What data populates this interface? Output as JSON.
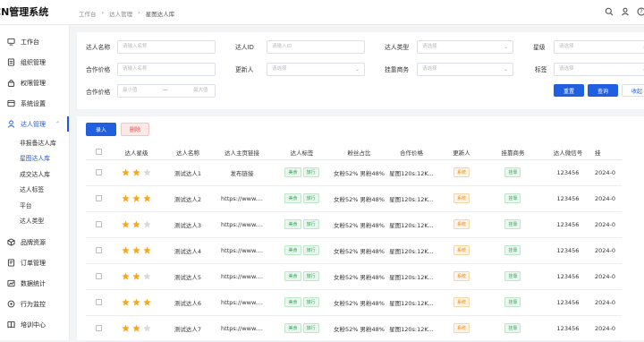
{
  "header": {
    "brand": "CN管理系统",
    "breadcrumb": [
      "工作台",
      "达人管理",
      "星图达人库"
    ]
  },
  "sidebar": {
    "items": [
      {
        "label": "工作台",
        "icon": "monitor-icon"
      },
      {
        "label": "组织管理",
        "icon": "org-icon"
      },
      {
        "label": "权限管理",
        "icon": "lock-icon"
      },
      {
        "label": "系统设置",
        "icon": "settings-icon"
      },
      {
        "label": "达人管理",
        "icon": "user-icon"
      }
    ],
    "sub_items": [
      "非报备达人库",
      "星图达人库",
      "成交达人库",
      "达人标签",
      "平台",
      "达人类型"
    ],
    "bottom_items": [
      {
        "label": "品牌资源",
        "icon": "cube-icon"
      },
      {
        "label": "订单管理",
        "icon": "order-icon"
      },
      {
        "label": "数据统计",
        "icon": "chart-icon"
      },
      {
        "label": "行为监控",
        "icon": "monitor-eye-icon"
      },
      {
        "label": "培训中心",
        "icon": "book-icon"
      }
    ]
  },
  "filters": {
    "name_label": "达人名称",
    "name_placeholder": "请输入名称",
    "id_label": "达人ID",
    "id_placeholder": "请输入ID",
    "type_label": "达人类型",
    "type_placeholder": "请选择",
    "level_label": "星级",
    "level_placeholder": "请选择",
    "price_label": "合作价格",
    "price_placeholder": "请输入名称",
    "updater_label": "更新人",
    "updater_placeholder": "请选择",
    "merchant_label": "挂靠商务",
    "merchant_placeholder": "请选择",
    "tag_label": "标签",
    "tag_placeholder": "请选择",
    "price_range_label": "合作价格",
    "min_placeholder": "最小值",
    "range_sep": "—",
    "max_placeholder": "最大值",
    "reset": "重置",
    "query": "查询",
    "collapse": "收起"
  },
  "actions": {
    "add": "录入",
    "delete": "删除"
  },
  "table": {
    "headers": [
      "达人星级",
      "达人名称",
      "达人主页链接",
      "达人标签",
      "粉丝占比",
      "合作价格",
      "更新人",
      "挂靠商务",
      "达人微信号",
      "挂"
    ],
    "rows": [
      {
        "stars": 2,
        "name": "测试达人1",
        "link": "发布链接",
        "tags": [
          "美食",
          "旅行"
        ],
        "fans": "女粉52% 男粉48%",
        "price": "星图120s:12K...",
        "updater": "系统",
        "merchant": "挂靠",
        "wechat": "123456",
        "date": "2024-0"
      },
      {
        "stars": 3,
        "name": "测试达人2",
        "link": "https://www....",
        "tags": [
          "美食",
          "旅行"
        ],
        "fans": "女粉52% 男粉48%",
        "price": "星图120s:12K...",
        "updater": "系统",
        "merchant": "挂靠",
        "wechat": "123456",
        "date": "2024-0"
      },
      {
        "stars": 2,
        "name": "测试达人3",
        "link": "https://www....",
        "tags": [
          "美食",
          "旅行"
        ],
        "fans": "女粉52% 男粉48%",
        "price": "星图120s:12K...",
        "updater": "系统",
        "merchant": "挂靠",
        "wechat": "123456",
        "date": "2024-0"
      },
      {
        "stars": 3,
        "name": "测试达人4",
        "link": "https://www....",
        "tags": [
          "美食",
          "旅行"
        ],
        "fans": "女粉52% 男粉48%",
        "price": "星图120s:12K...",
        "updater": "系统",
        "merchant": "挂靠",
        "wechat": "123456",
        "date": "2024-0"
      },
      {
        "stars": 2,
        "name": "测试达人5",
        "link": "https://www....",
        "tags": [
          "美食",
          "旅行"
        ],
        "fans": "女粉52% 男粉48%",
        "price": "星图120s:12K...",
        "updater": "系统",
        "merchant": "挂靠",
        "wechat": "123456",
        "date": "2024-0"
      },
      {
        "stars": 3,
        "name": "测试达人6",
        "link": "https://www....",
        "tags": [
          "美食",
          "旅行"
        ],
        "fans": "女粉52% 男粉48%",
        "price": "星图120s:12K...",
        "updater": "系统",
        "merchant": "挂靠",
        "wechat": "123456",
        "date": "2024-0"
      },
      {
        "stars": 2,
        "name": "测试达人7",
        "link": "https://www....",
        "tags": [
          "美食",
          "旅行"
        ],
        "fans": "女粉52% 男粉48%",
        "price": "星图120s:12K...",
        "updater": "系统",
        "merchant": "挂靠",
        "wechat": "123456",
        "date": "2024-0"
      }
    ]
  },
  "colors": {
    "primary": "#1f5fe0",
    "star": "#f5a623",
    "star_empty": "#d9d9d9"
  }
}
